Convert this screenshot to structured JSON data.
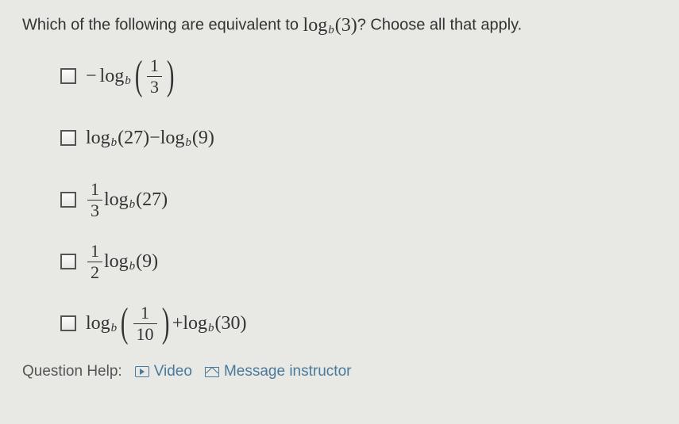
{
  "question": {
    "prompt_pre": "Which of the following are equivalent to ",
    "prompt_expr_log": "log",
    "prompt_expr_sub": "b",
    "prompt_expr_arg": "(3)",
    "prompt_post": "? Choose all that apply."
  },
  "options": {
    "a": {
      "minus": "−",
      "log": "log",
      "sub": "b",
      "lp": "(",
      "frac_num": "1",
      "frac_den": "3",
      "rp": ")"
    },
    "b": {
      "log1": "log",
      "sub1": "b",
      "arg1": "(27)",
      "minus": " − ",
      "log2": "log",
      "sub2": "b",
      "arg2": "(9)"
    },
    "c": {
      "frac_num": "1",
      "frac_den": "3",
      "log": "log",
      "sub": "b",
      "arg": "(27)"
    },
    "d": {
      "frac_num": "1",
      "frac_den": "2",
      "log": "log",
      "sub": "b",
      "arg": "(9)"
    },
    "e": {
      "log1": "log",
      "sub1": "b",
      "lp": "(",
      "frac_num": "1",
      "frac_den": "10",
      "rp": ")",
      "plus": " + ",
      "log2": "log",
      "sub2": "b",
      "arg2": "(30)"
    }
  },
  "help": {
    "label": "Question Help:",
    "video": "Video",
    "message": "Message instructor"
  }
}
